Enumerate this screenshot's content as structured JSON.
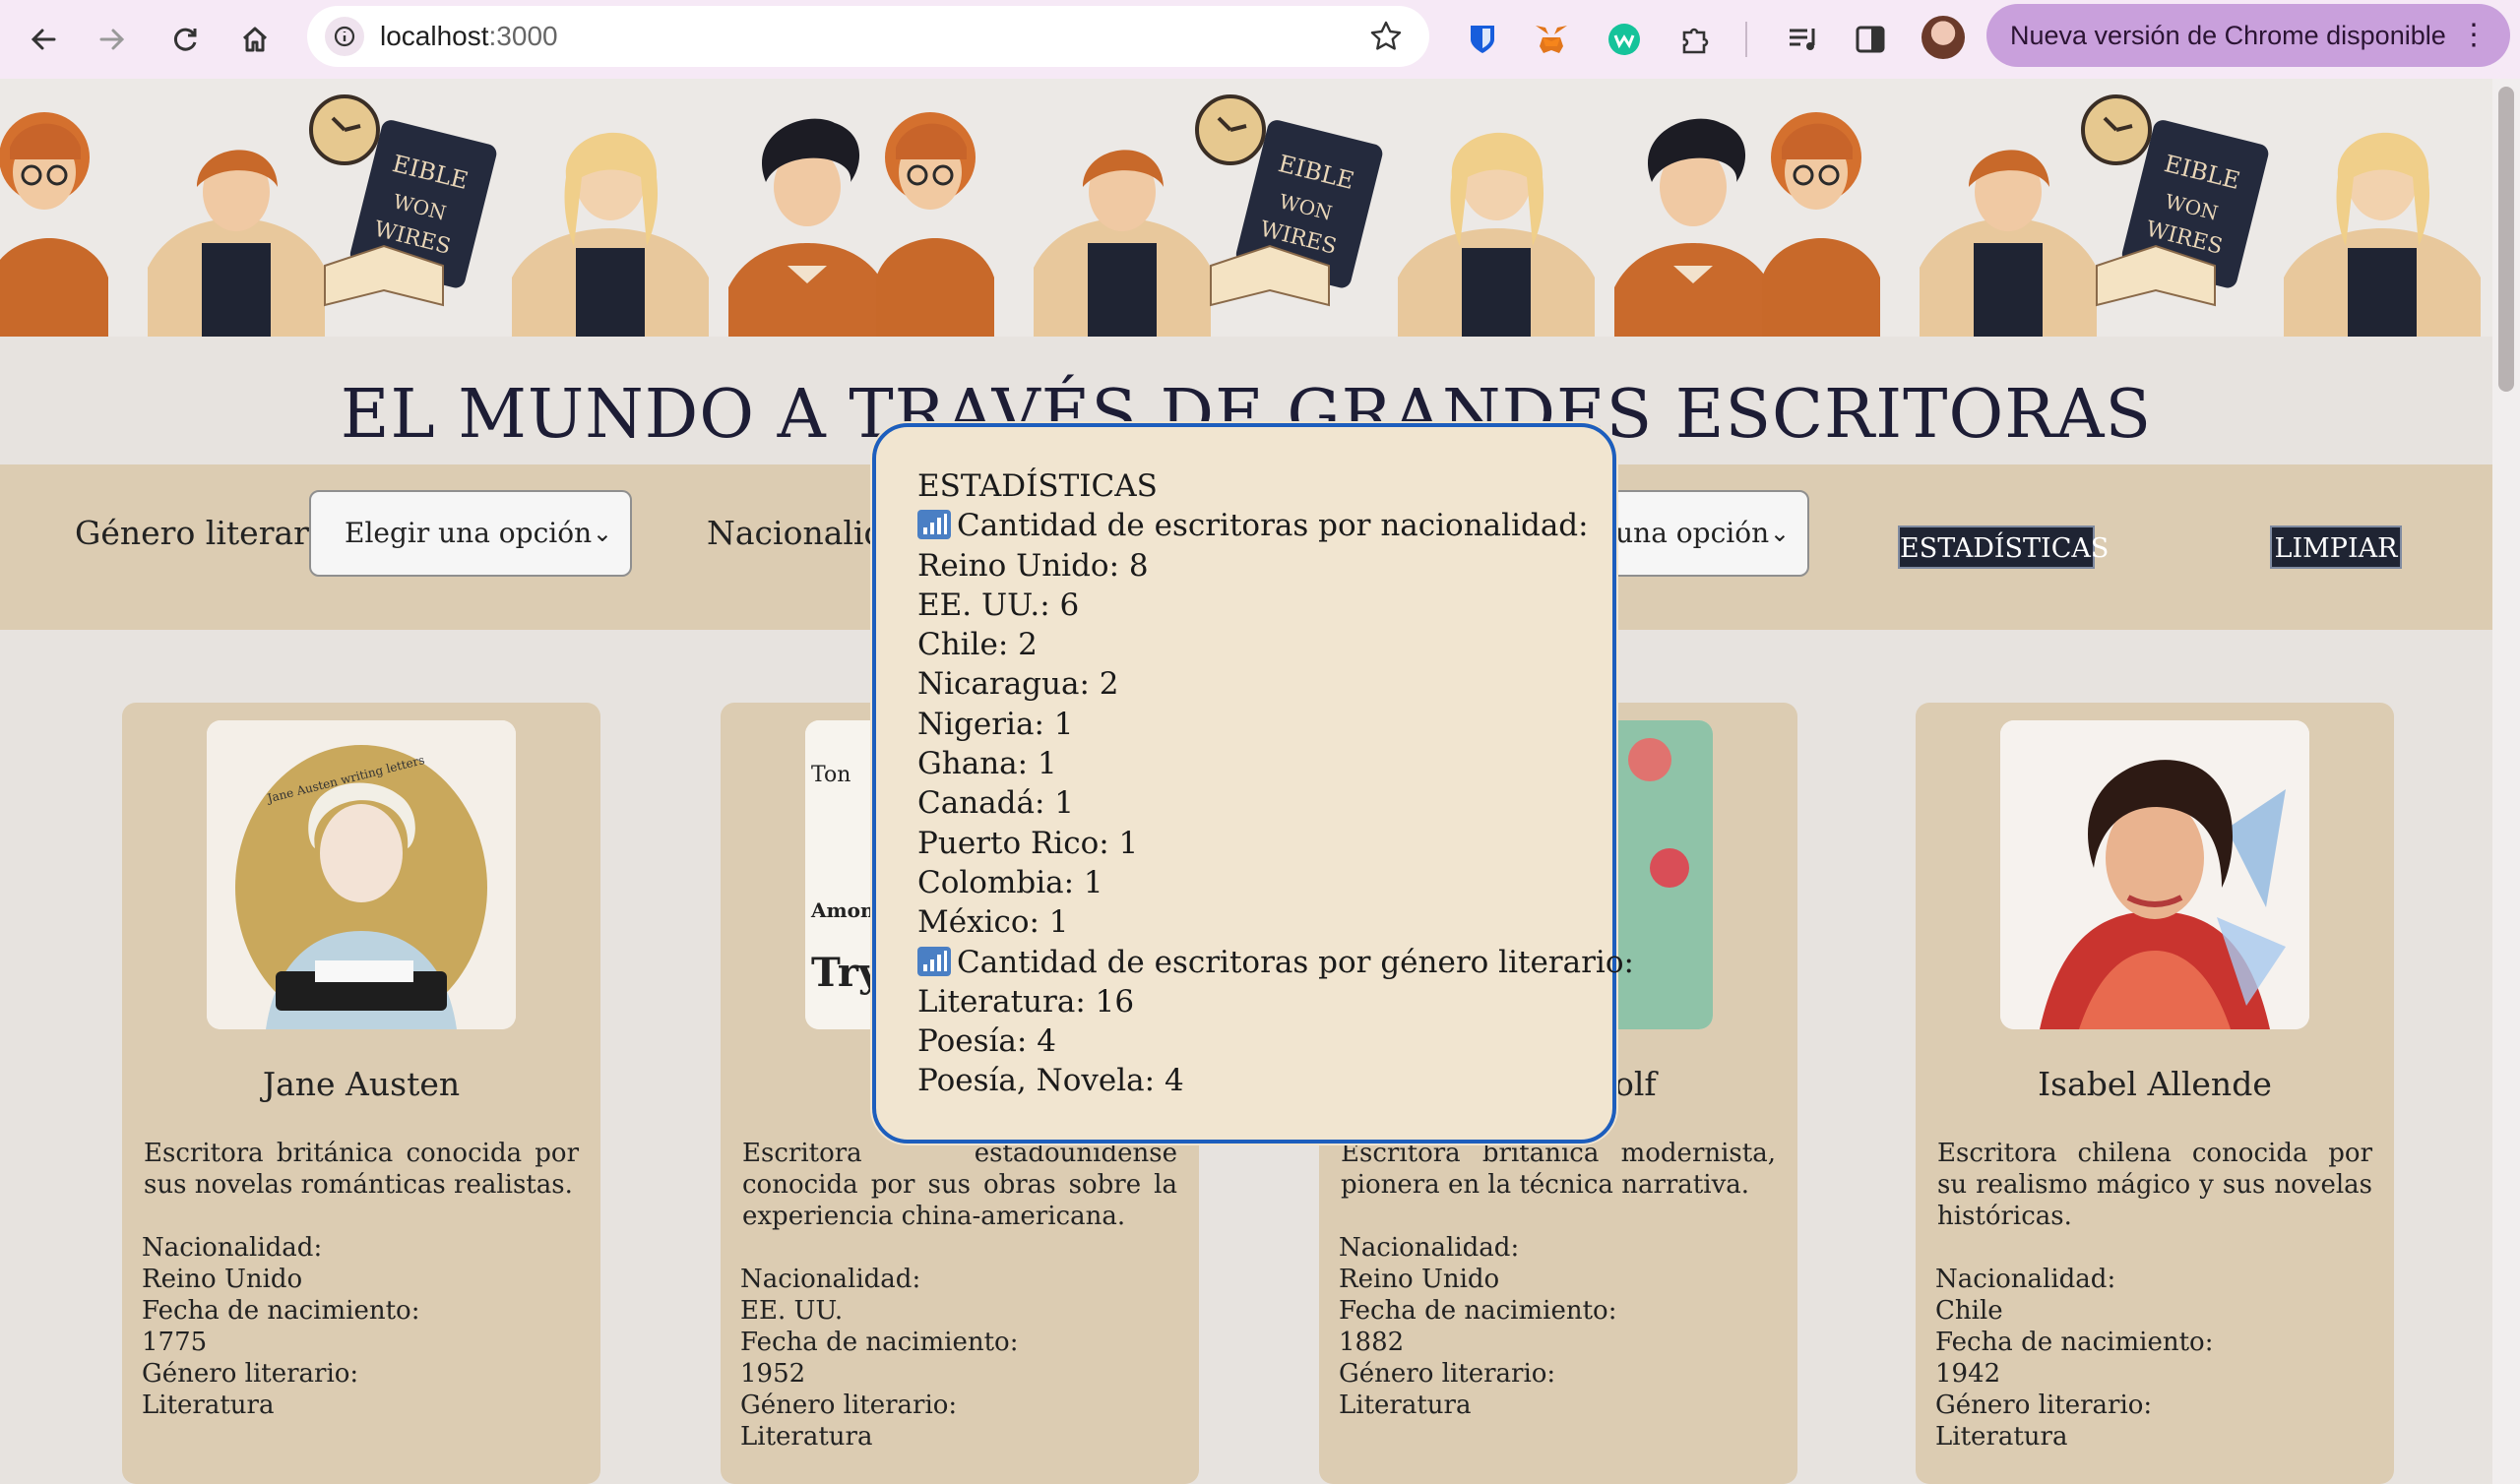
{
  "browser": {
    "url_host": "localhost",
    "url_port": ":3000",
    "update_label": "Nueva versión de Chrome disponible"
  },
  "page": {
    "title": "EL MUNDO A TRAVÉS DE GRANDES ESCRITORAS"
  },
  "filters": {
    "genre_label": "Género literario:",
    "genre_value": "Elegir una opción",
    "nationality_label": "Nacionalidad:",
    "nationality_value": "Elegir una opción",
    "stats_button": "ESTADÍSTICAS",
    "clear_button": "LIMPIAR"
  },
  "cards": [
    {
      "name": "Jane Austen",
      "description": "Escritora británica conocida por sus novelas románticas realistas.",
      "nationality_label": "Nacionalidad:",
      "nationality": "Reino Unido",
      "birth_label": "Fecha de nacimiento:",
      "birth": "1775",
      "genre_label": "Género literario:",
      "genre": "Literatura"
    },
    {
      "name": "",
      "description": "Escritora estadounidense conocida por sus obras sobre la experiencia china-americana.",
      "nationality_label": "Nacionalidad:",
      "nationality": "EE. UU.",
      "birth_label": "Fecha de nacimiento:",
      "birth": "1952",
      "genre_label": "Género literario:",
      "genre": "Literatura"
    },
    {
      "name": "olf",
      "description": "Escritora británica modernista, pionera en la técnica narrativa.",
      "nationality_label": "Nacionalidad:",
      "nationality": "Reino Unido",
      "birth_label": "Fecha de nacimiento:",
      "birth": "1882",
      "genre_label": "Género literario:",
      "genre": "Literatura"
    },
    {
      "name": "Isabel Allende",
      "description": "Escritora chilena conocida por su realismo mágico y sus novelas históricas.",
      "nationality_label": "Nacionalidad:",
      "nationality": "Chile",
      "birth_label": "Fecha de nacimiento:",
      "birth": "1942",
      "genre_label": "Género literario:",
      "genre": "Literatura"
    }
  ],
  "stats": {
    "title": "ESTADÍSTICAS",
    "by_nationality_heading": "Cantidad de escritoras por nacionalidad:",
    "by_nationality": [
      "Reino Unido: 8",
      "EE. UU.: 6",
      "Chile: 2",
      "Nicaragua: 2",
      "Nigeria: 1",
      "Ghana: 1",
      "Canadá: 1",
      "Puerto Rico: 1",
      "Colombia: 1",
      "México: 1"
    ],
    "by_genre_heading": "Cantidad de escritoras por género literario:",
    "by_genre": [
      "Literatura: 16",
      "Poesía: 4",
      "Poesía, Novela: 4"
    ]
  },
  "colors": {
    "browser_bar": "#f6e9f6",
    "panel": "#dcccb2",
    "modal_border": "#1d5ebd",
    "button_dark": "#1f2433"
  },
  "icons": [
    "back-icon",
    "forward-icon",
    "reload-icon",
    "home-icon",
    "site-info-icon",
    "star-icon",
    "bar-chart-icon"
  ]
}
